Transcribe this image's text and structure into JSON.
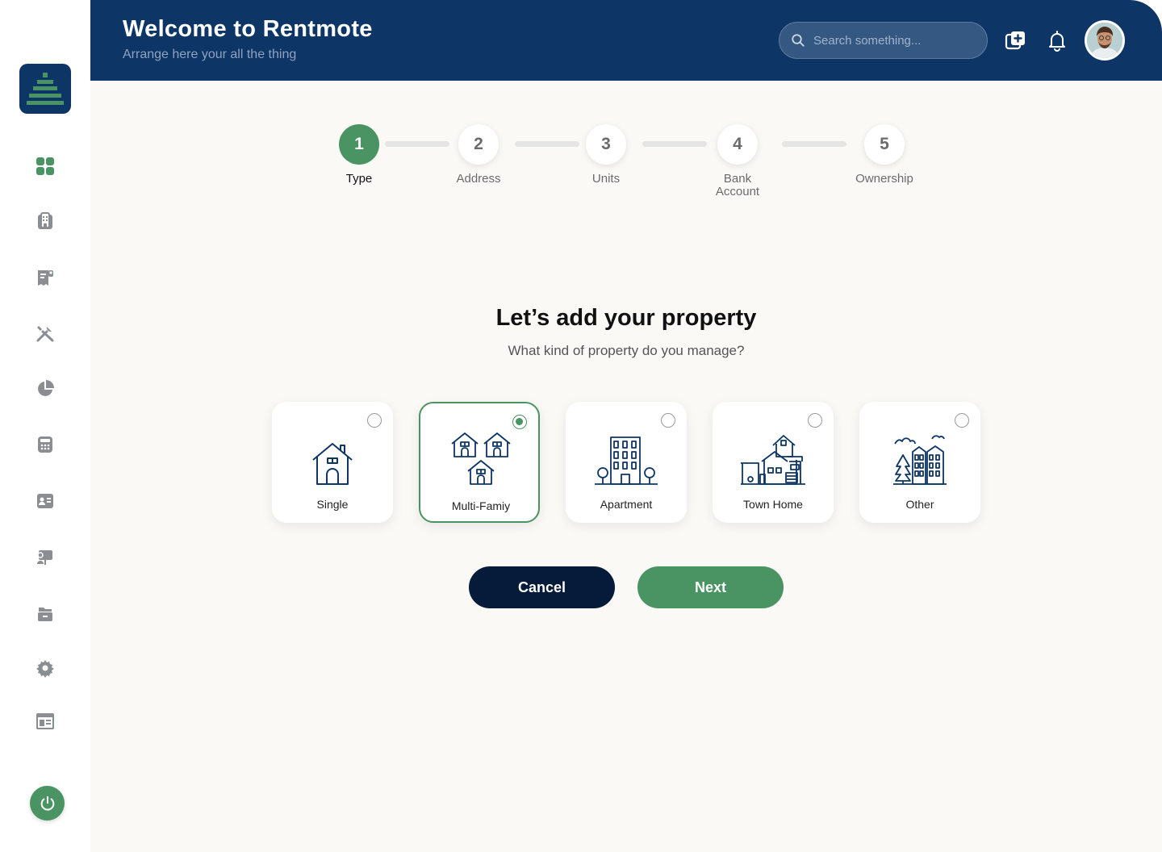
{
  "app": {
    "logo": "rentmote-stack-logo"
  },
  "header": {
    "title": "Welcome to Rentmote",
    "subtitle": "Arrange here your all the thing",
    "search_placeholder": "Search something...",
    "icons": [
      "add-copy-icon",
      "bell-icon"
    ]
  },
  "sidebar": {
    "items": [
      {
        "icon": "dashboard-grid-icon",
        "active": true
      },
      {
        "icon": "building-icon"
      },
      {
        "icon": "receipt-icon"
      },
      {
        "icon": "tools-icon"
      },
      {
        "icon": "pie-chart-icon"
      },
      {
        "icon": "calculator-icon"
      },
      {
        "icon": "contact-card-icon"
      },
      {
        "icon": "presentation-icon"
      },
      {
        "icon": "archive-icon"
      },
      {
        "icon": "settings-gear-icon"
      },
      {
        "icon": "layout-icon"
      }
    ],
    "power_icon": "power-icon"
  },
  "stepper": {
    "steps": [
      {
        "number": "1",
        "label": "Type",
        "active": true
      },
      {
        "number": "2",
        "label": "Address"
      },
      {
        "number": "3",
        "label": "Units"
      },
      {
        "number": "4",
        "label": "Bank Account"
      },
      {
        "number": "5",
        "label": "Ownership"
      }
    ]
  },
  "form": {
    "heading": "Let’s add your property",
    "subheading": "What kind of property do you manage?",
    "options": [
      {
        "label": "Single",
        "icon": "single-house-icon",
        "selected": false
      },
      {
        "label": "Multi-Famiy",
        "icon": "multi-family-icon",
        "selected": true
      },
      {
        "label": "Apartment",
        "icon": "apartment-building-icon",
        "selected": false
      },
      {
        "label": "Town Home",
        "icon": "town-home-icon",
        "selected": false
      },
      {
        "label": "Other",
        "icon": "other-buildings-icon",
        "selected": false
      }
    ],
    "cancel_label": "Cancel",
    "next_label": "Next"
  },
  "colors": {
    "navy": "#0d3566",
    "green": "#4a9363",
    "dark_button": "#061a3a",
    "background": "#faf9f6",
    "icon_gray": "#8a8d91"
  }
}
